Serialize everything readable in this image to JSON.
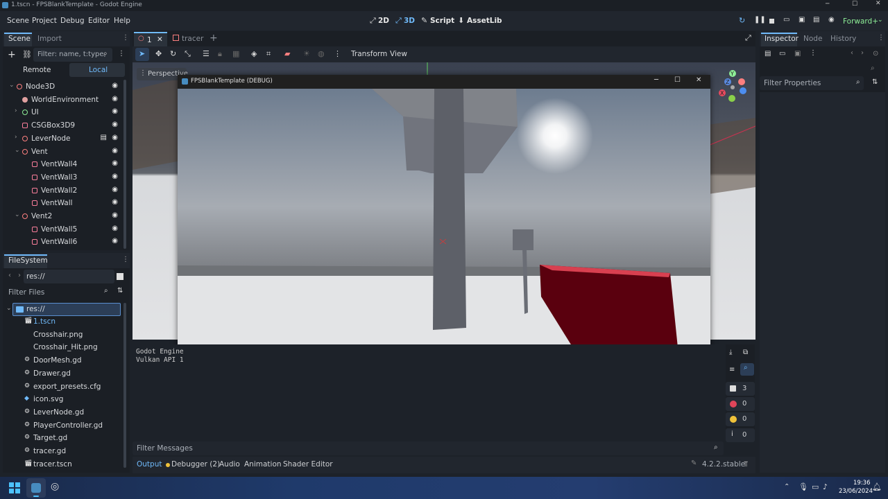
{
  "window_title": "1.tscn - FPSBlankTemplate - Godot Engine",
  "menu": [
    "Scene",
    "Project",
    "Debug",
    "Editor",
    "Help"
  ],
  "modes": {
    "d2": "2D",
    "d3": "3D",
    "script": "Script",
    "assetlib": "AssetLib"
  },
  "renderer": "Forward+",
  "scene_tabs": {
    "scene": "Scene",
    "import": "Import"
  },
  "scene_filter_placeholder": "Filter: name, t:type,",
  "remote": "Remote",
  "local": "Local",
  "tree": [
    {
      "label": "Node3D",
      "icon": "node3d-icon"
    },
    {
      "label": "WorldEnvironment",
      "icon": "world-environment-icon"
    },
    {
      "label": "UI",
      "icon": "control-icon"
    },
    {
      "label": "CSGBox3D9",
      "icon": "csg-box-icon"
    },
    {
      "label": "LeverNode",
      "icon": "node3d-icon"
    },
    {
      "label": "Vent",
      "icon": "node3d-icon"
    },
    {
      "label": "VentWall4",
      "icon": "csg-box-icon"
    },
    {
      "label": "VentWall3",
      "icon": "csg-box-icon"
    },
    {
      "label": "VentWall2",
      "icon": "csg-box-icon"
    },
    {
      "label": "VentWall",
      "icon": "csg-box-icon"
    },
    {
      "label": "Vent2",
      "icon": "node3d-icon"
    },
    {
      "label": "VentWall5",
      "icon": "csg-box-icon"
    },
    {
      "label": "VentWall6",
      "icon": "csg-box-icon"
    }
  ],
  "filesystem": {
    "title": "FileSystem",
    "path": "res://",
    "filter_placeholder": "Filter Files",
    "root": "res://",
    "files": [
      "1.tscn",
      "Crosshair.png",
      "Crosshair_Hit.png",
      "DoorMesh.gd",
      "Drawer.gd",
      "export_presets.cfg",
      "icon.svg",
      "LeverNode.gd",
      "PlayerController.gd",
      "Target.gd",
      "tracer.gd",
      "tracer.tscn"
    ]
  },
  "editor_tabs": [
    {
      "label": "1"
    },
    {
      "label": "tracer"
    }
  ],
  "viewport_toolbar": {
    "transform": "Transform",
    "view": "View"
  },
  "perspective": "Perspective",
  "game_window_title": "FPSBlankTemplate (DEBUG)",
  "output_lines": [
    "Godot Engine",
    "Vulkan API 1"
  ],
  "counters": [
    "3",
    "0",
    "0",
    "0"
  ],
  "filter_messages": "Filter Messages",
  "bottom_tabs": {
    "output": "Output",
    "debugger": "Debugger (2)",
    "audio": "Audio",
    "animation": "Animation",
    "shader_editor": "Shader Editor"
  },
  "version": "4.2.2.stable",
  "inspector_tabs": {
    "inspector": "Inspector",
    "node": "Node",
    "history": "History"
  },
  "filter_properties": "Filter Properties",
  "clock": {
    "time": "19:36",
    "date": "23/06/2024"
  },
  "colors": {
    "accent": "#70bafa",
    "node_red": "#fc7f7f",
    "control_green": "#8eef97",
    "csg_pink": "#fc7f9c",
    "bg": "#1d2229",
    "panel": "#21262e"
  }
}
